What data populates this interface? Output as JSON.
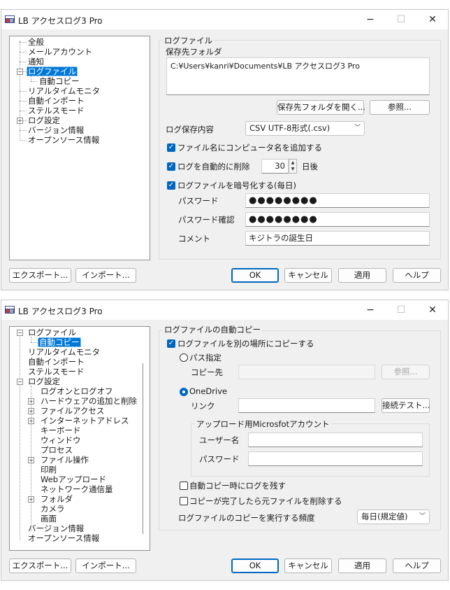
{
  "window1": {
    "title": "LB アクセスログ3 Pro",
    "tree": [
      "全般",
      "メールアカウント",
      "通知",
      "ログファイル",
      "自動コピー",
      "リアルタイムモニタ",
      "自動インポート",
      "ステルスモード",
      "ログ設定",
      "バージョン情報",
      "オープンソース情報"
    ],
    "group_title": "ログファイル",
    "folder_label": "保存先フォルダ",
    "folder_path": "C:¥Users¥kanri¥Documents¥LB アクセスログ3 Pro",
    "open_folder_button": "保存先フォルダを開く...",
    "browse_button": "参照...",
    "content_label": "ログ保存内容",
    "content_value": "CSV UTF-8形式(.csv)",
    "chk_computer_name": "ファイル名にコンピュータ名を追加する",
    "chk_auto_delete": "ログを自動的に削除",
    "days_value": "30",
    "days_unit": "日後",
    "chk_encrypt": "ログファイルを暗号化する(毎日)",
    "password_label": "パスワード",
    "password_value": "●●●●●●●●",
    "password_confirm_label": "パスワード確認",
    "password_confirm_value": "●●●●●●●●",
    "comment_label": "コメント",
    "comment_value": "キジトラの誕生日",
    "export_button": "エクスポート...",
    "import_button": "インポート...",
    "ok_button": "OK",
    "cancel_button": "キャンセル",
    "apply_button": "適用",
    "help_button": "ヘルプ"
  },
  "window2": {
    "title": "LB アクセスログ3 Pro",
    "tree": [
      "ログファイル",
      "自動コピー",
      "リアルタイムモニタ",
      "自動インポート",
      "ステルスモード",
      "ログ設定",
      "ログオンとログオフ",
      "ハードウェアの追加と削除",
      "ファイルアクセス",
      "インターネットアドレス",
      "キーボード",
      "ウィンドウ",
      "プロセス",
      "ファイル操作",
      "印刷",
      "Webアップロード",
      "ネットワーク通信量",
      "フォルダ",
      "カメラ",
      "画面",
      "バージョン情報",
      "オープンソース情報"
    ],
    "group_title": "ログファイルの自動コピー",
    "chk_copy": "ログファイルを別の場所にコピーする",
    "radio_path": "パス指定",
    "dest_label": "コピー先",
    "browse_button": "参照...",
    "radio_onedrive": "OneDrive",
    "link_label": "リンク",
    "test_button": "接続テスト...",
    "account_group_title": "アップロード用Microsfotアカウント",
    "username_label": "ユーザー名",
    "password_label": "パスワード",
    "chk_keep_log": "自動コピー時にログを残す",
    "chk_delete_original": "コピーが完了したら元ファイルを削除する",
    "frequency_label": "ログファイルのコピーを実行する頻度",
    "frequency_value": "毎日(規定値)",
    "export_button": "エクスポート...",
    "import_button": "インポート...",
    "ok_button": "OK",
    "cancel_button": "キャンセル",
    "apply_button": "適用",
    "help_button": "ヘルプ"
  }
}
